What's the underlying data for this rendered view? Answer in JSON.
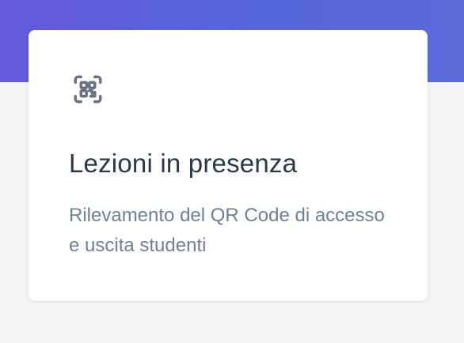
{
  "header": {
    "accent_color": "#5a62db"
  },
  "card": {
    "icon": "qr-code-scan-icon",
    "title": "Lezioni in presenza",
    "description": "Rilevamento del QR Code di accesso e uscita studenti"
  }
}
